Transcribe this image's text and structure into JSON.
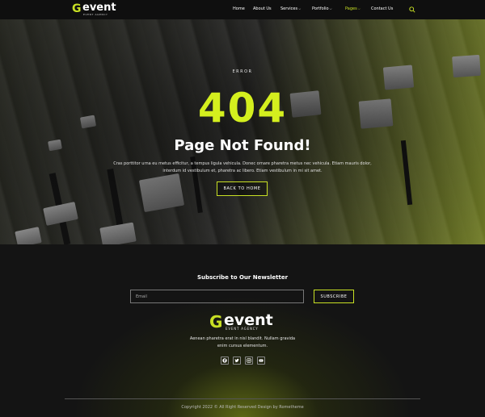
{
  "header": {
    "logo_letter": "G",
    "logo_word": "event",
    "logo_sub": "EVENT AGENCY",
    "nav": [
      {
        "label": "Home",
        "has_dropdown": false,
        "active": false
      },
      {
        "label": "About Us",
        "has_dropdown": false,
        "active": false
      },
      {
        "label": "Services",
        "has_dropdown": true,
        "active": false
      },
      {
        "label": "Portfolio",
        "has_dropdown": true,
        "active": false
      },
      {
        "label": "Pages",
        "has_dropdown": true,
        "active": true
      },
      {
        "label": "Contact Us",
        "has_dropdown": false,
        "active": false
      }
    ],
    "search_icon": "search-icon"
  },
  "hero": {
    "error_label": "ERROR",
    "code": "404",
    "title": "Page Not Found!",
    "description": "Cras porttitor urna eu metus efficitur, a tempus ligula vehicula. Donec ornare pharetra metus nec vehicula. Etiam mauris dolor, interdum id vestibulum et, pharetra ac libero. Etiam vestibulum in mi sit amet.",
    "button_label": "BACK TO HOME"
  },
  "footer": {
    "subscribe_title": "Subscribe to Our Newsletter",
    "email_placeholder": "Email",
    "subscribe_button": "SUBSCRIBE",
    "logo_letter": "G",
    "logo_word": "event",
    "logo_sub": "EVENT AGENCY",
    "about": "Aenean pharetra erat in nisl blandit. Nullam gravida enim cursus elementum.",
    "socials": [
      "facebook-icon",
      "twitter-icon",
      "instagram-icon",
      "youtube-icon"
    ],
    "copyright": "Copyright 2022 © All Right Reserved Design by Rometheme"
  },
  "colors": {
    "accent": "#c8e024",
    "background": "#141414",
    "header_bg": "#0f0f0f"
  }
}
